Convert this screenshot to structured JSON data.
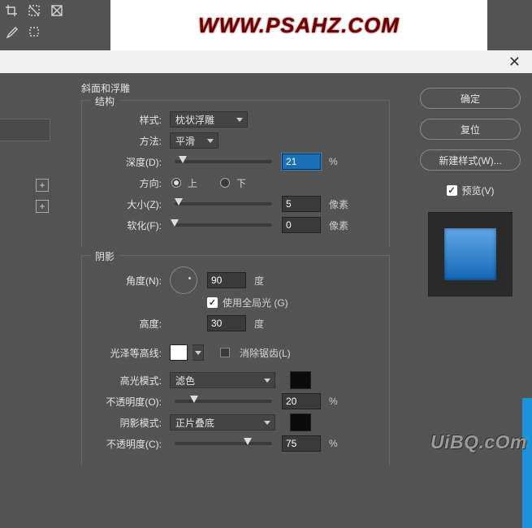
{
  "watermark_top": "WWW.PSAHZ.COM",
  "watermark_bottom": "UiBQ.cOm",
  "buttons": {
    "ok": "确定",
    "reset": "复位",
    "new_style": "新建样式(W)...",
    "preview": "预览(V)"
  },
  "section_title": "斜面和浮雕",
  "structure": {
    "legend": "结构",
    "style_label": "样式:",
    "style_value": "枕状浮雕",
    "method_label": "方法:",
    "method_value": "平滑",
    "depth_label": "深度(D):",
    "depth_value": "21",
    "depth_unit": "%",
    "direction_label": "方向:",
    "direction_up": "上",
    "direction_down": "下",
    "size_label": "大小(Z):",
    "size_value": "5",
    "size_unit": "像素",
    "soften_label": "软化(F):",
    "soften_value": "0",
    "soften_unit": "像素"
  },
  "shading": {
    "legend": "阴影",
    "angle_label": "角度(N):",
    "angle_value": "90",
    "angle_unit": "度",
    "global_light": "使用全局光 (G)",
    "altitude_label": "高度:",
    "altitude_value": "30",
    "altitude_unit": "度",
    "gloss_label": "光泽等高线:",
    "antialias": "消除锯齿(L)",
    "highlight_mode_label": "高光模式:",
    "highlight_mode_value": "滤色",
    "highlight_opacity_label": "不透明度(O):",
    "highlight_opacity_value": "20",
    "highlight_opacity_unit": "%",
    "shadow_mode_label": "阴影模式:",
    "shadow_mode_value": "正片叠底",
    "shadow_opacity_label": "不透明度(C):",
    "shadow_opacity_value": "75",
    "shadow_opacity_unit": "%"
  }
}
